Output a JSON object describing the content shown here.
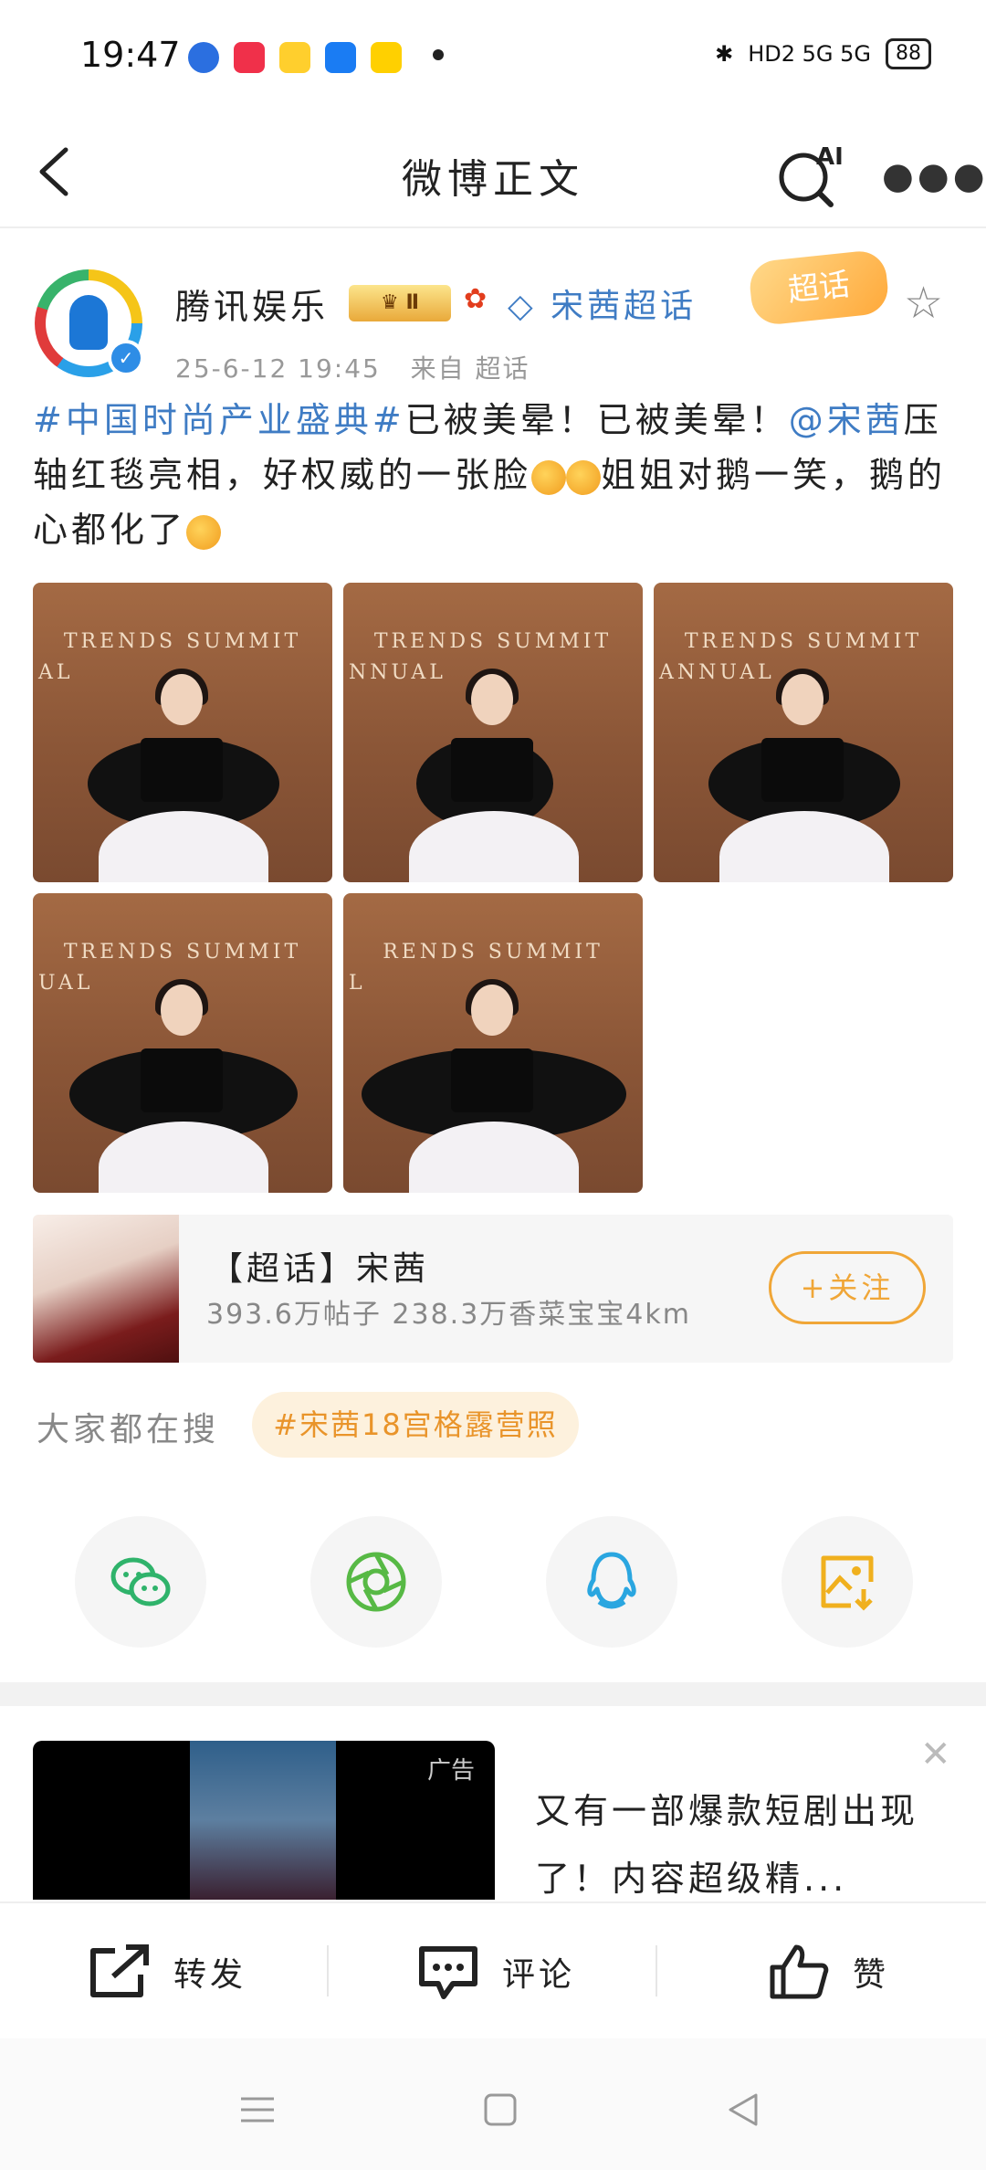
{
  "status_bar": {
    "time": "19:47",
    "network": "HD2 5G 5G",
    "battery": "88"
  },
  "header": {
    "title": "微博正文",
    "ai_label": "AI"
  },
  "post": {
    "author": "腾讯娱乐",
    "crown_badge": "Ⅱ",
    "super_topic": "宋茜超话",
    "super_badge": "超话",
    "time": "25-6-12 19:45",
    "source": "来自 超话",
    "text_tag": "#中国时尚产业盛典#",
    "text_1": "已被美晕！已被美晕！",
    "mention": "@宋茜",
    "text_2": "压轴红毯亮相，好权威的一张脸",
    "text_3": "姐姐对鹅一笑，鹅的心都化了"
  },
  "photos": [
    {
      "sign": "TRENDS SUMMIT",
      "sign2": "AL"
    },
    {
      "sign": "TRENDS SUMMIT",
      "sign2": "NNUAL"
    },
    {
      "sign": "TRENDS SUMMIT",
      "sign2": "ANNUAL"
    },
    {
      "sign": "TRENDS SUMMIT",
      "sign2": "UAL"
    },
    {
      "sign": "RENDS SUMMIT",
      "sign2": "L"
    }
  ],
  "topic_card": {
    "title": "【超话】宋茜",
    "subtitle": "393.6万帖子 238.3万香菜宝宝4km",
    "follow": "+关注"
  },
  "search": {
    "label": "大家都在搜",
    "hot": "#宋茜18宫格露营照"
  },
  "share_icons": [
    "wechat-icon",
    "moments-icon",
    "qq-icon",
    "save-image-icon"
  ],
  "ad": {
    "label": "广告",
    "text": "又有一部爆款短剧出现了！内容超级精..."
  },
  "actions": {
    "repost": "转发",
    "comment": "评论",
    "like": "赞"
  },
  "colors": {
    "link": "#3f7cc4",
    "accent": "#f0a637"
  }
}
